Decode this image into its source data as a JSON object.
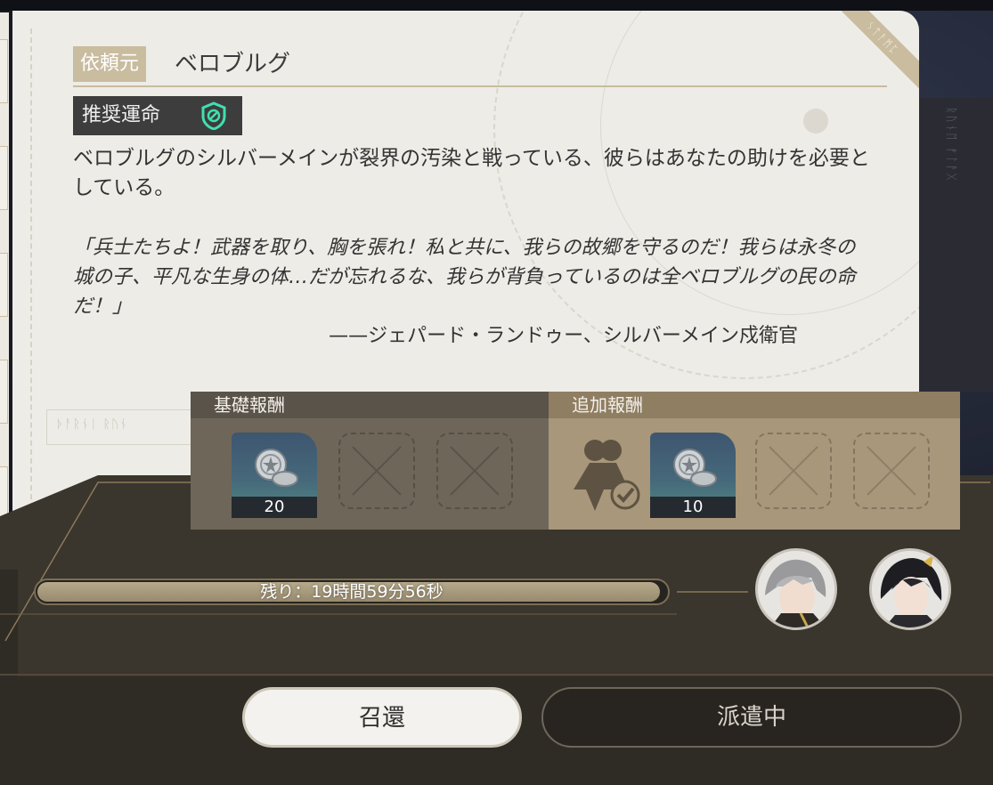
{
  "commission": {
    "client_label": "依頼元",
    "client_name": "ベロブルグ",
    "recommended_label": "推奨運命",
    "recommended_icon": "preservation-path-icon",
    "description": "ベロブルグのシルバーメインが裂界の汚染と戦っている、彼らはあなたの助けを必要としている。",
    "quote": "「兵士たちよ！武器を取り、胸を張れ！私と共に、我らの故郷を守るのだ！我らは永冬の城の子、平凡な生身の体…だが忘れるな、我らが背負っているのは全ベロブルグの民の命だ！」",
    "attribution": "——ジェパード・ランドゥー、シルバーメイン戍衛官"
  },
  "rewards": {
    "base": {
      "label": "基礎報酬",
      "items": [
        {
          "icon": "credit-coin-icon",
          "count": "20"
        }
      ],
      "empty_slots": 2
    },
    "extra": {
      "label": "追加報酬",
      "condition_icon": "trailblazer-check-icon",
      "items": [
        {
          "icon": "credit-coin-icon",
          "count": "10"
        }
      ],
      "empty_slots": 2
    }
  },
  "progress": {
    "label": "残り：19時間59分56秒",
    "fraction": 0.99
  },
  "dispatch": {
    "avatars": [
      "avatar-silver-haired",
      "avatar-dark-haired"
    ]
  },
  "buttons": {
    "recall": "召還",
    "dispatching": "派遣中"
  },
  "colors": {
    "accent": "#c9bc9f",
    "paper": "#eeece7",
    "base_reward": "#6e6659",
    "extra_reward": "#a8977a",
    "recommend_icon": "#3fe0b0"
  }
}
